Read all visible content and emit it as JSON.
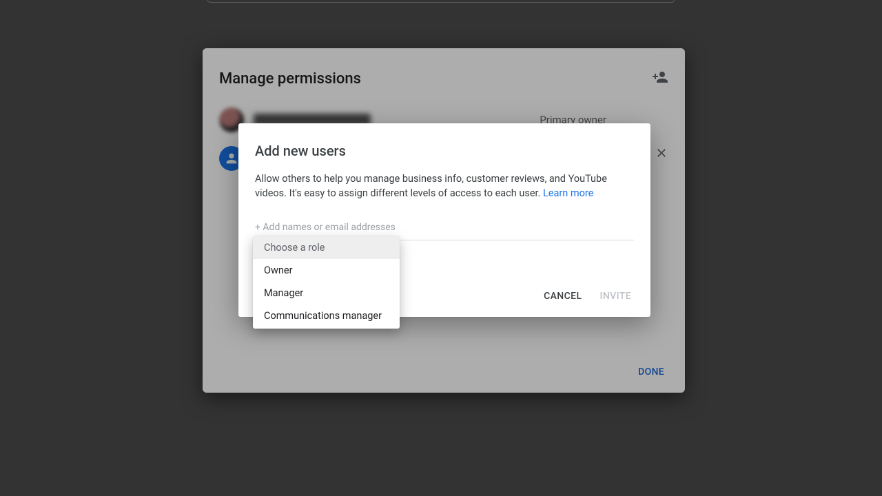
{
  "panel": {
    "title": "Manage permissions",
    "primary_role_label": "Primary owner",
    "done_label": "DONE"
  },
  "dialog": {
    "title": "Add new users",
    "desc_text": "Allow others to help you manage business info, customer reviews, and YouTube videos. It's easy to assign different levels of access to each user. ",
    "learn_more_label": "Learn more",
    "input_placeholder": "+ Add names or email addresses",
    "cancel_label": "CANCEL",
    "invite_label": "INVITE"
  },
  "dropdown": {
    "placeholder": "Choose a role",
    "options": [
      "Owner",
      "Manager",
      "Communications manager"
    ]
  }
}
